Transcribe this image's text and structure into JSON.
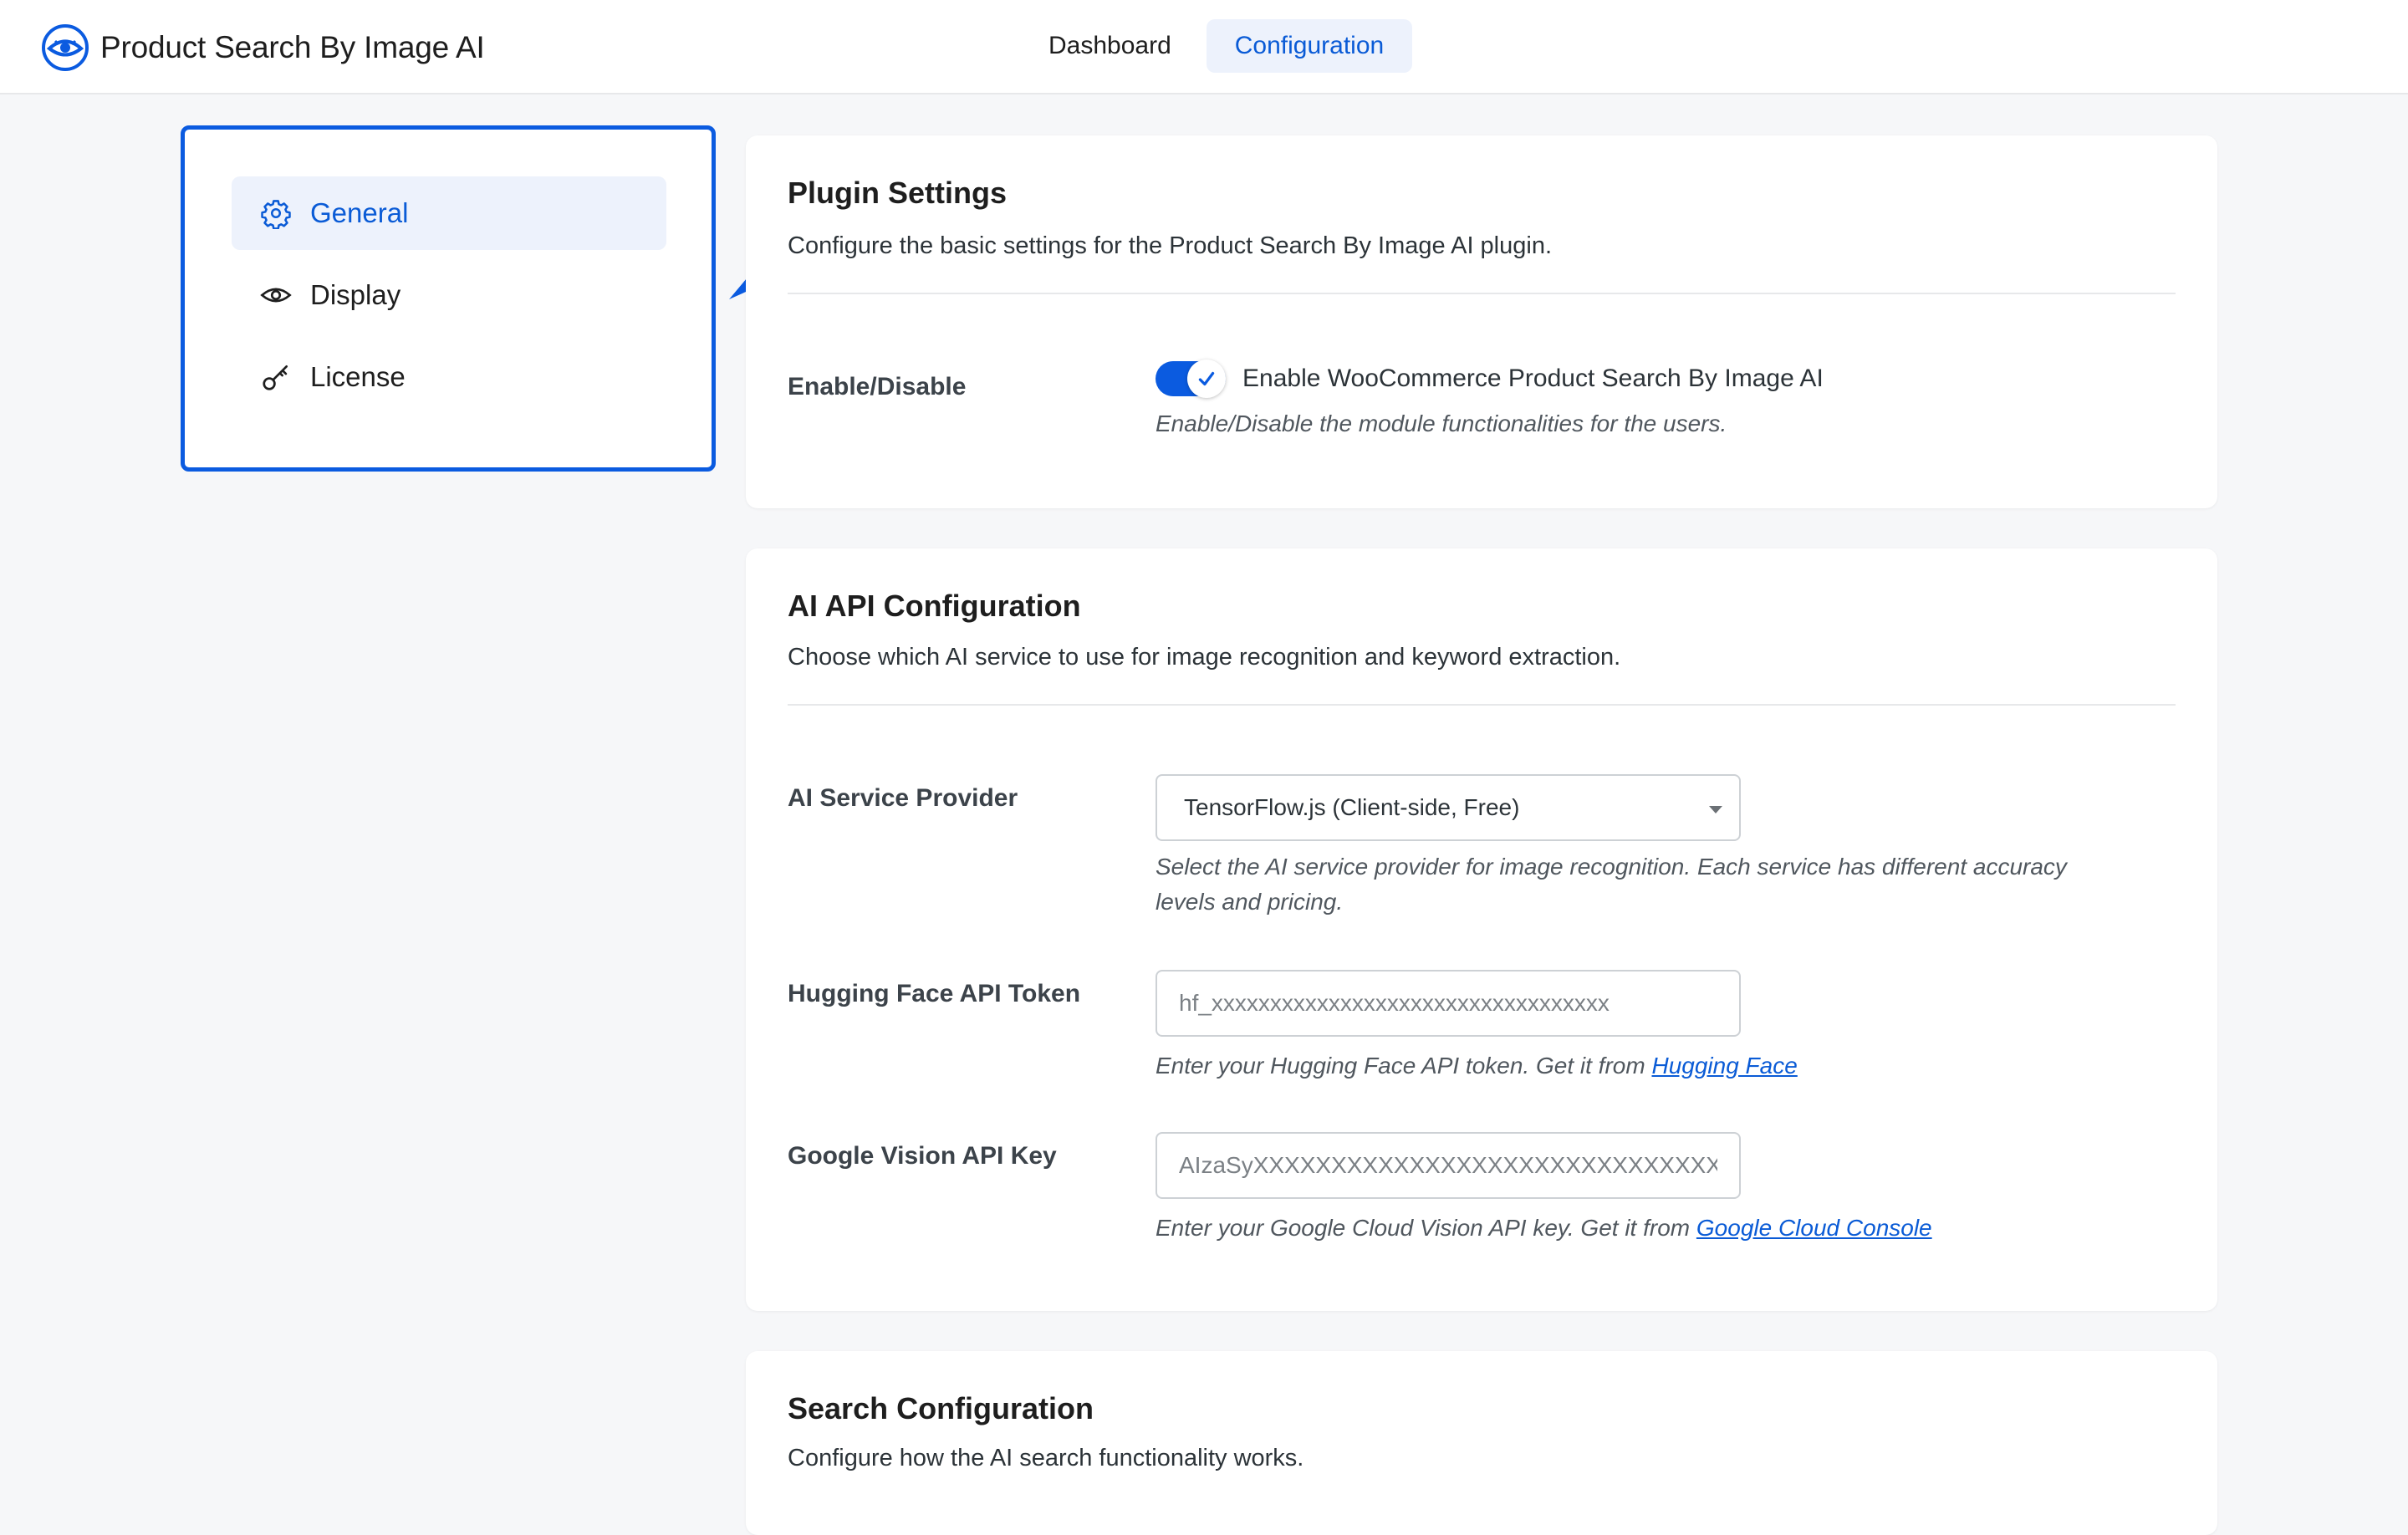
{
  "header": {
    "brand_title": "Product Search By Image AI",
    "brand_icon": "eye-search-icon",
    "tabs": [
      {
        "label": "Dashboard",
        "active": false
      },
      {
        "label": "Configuration",
        "active": true
      }
    ]
  },
  "sidebar": {
    "items": [
      {
        "label": "General",
        "icon": "gear-icon",
        "active": true
      },
      {
        "label": "Display",
        "icon": "eye-icon",
        "active": false
      },
      {
        "label": "License",
        "icon": "key-icon",
        "active": false
      }
    ]
  },
  "plugin_settings": {
    "title": "Plugin Settings",
    "description": "Configure the basic settings for the Product Search By Image AI plugin.",
    "enable_label": "Enable/Disable",
    "enable_toggle_label": "Enable WooCommerce Product Search By Image AI",
    "enable_help": "Enable/Disable the module functionalities for the users.",
    "enabled": true
  },
  "ai_api": {
    "title": "AI API Configuration",
    "description": "Choose which AI service to use for image recognition and keyword extraction.",
    "provider_label": "AI Service Provider",
    "provider_value": "TensorFlow.js (Client-side, Free)",
    "provider_help_line1": "Select the AI service provider for image recognition. Each service has different accuracy",
    "provider_help_line2": "levels and pricing.",
    "hf_label": "Hugging Face API Token",
    "hf_placeholder": "hf_xxxxxxxxxxxxxxxxxxxxxxxxxxxxxxxxxx",
    "hf_help": "Enter your Hugging Face API token. Get it from ",
    "hf_link": "Hugging Face",
    "gv_label": "Google Vision API Key",
    "gv_placeholder": "AIzaSyXXXXXXXXXXXXXXXXXXXXXXXXXXXXXXX",
    "gv_help": "Enter your Google Cloud Vision API key. Get it from ",
    "gv_link": "Google Cloud Console"
  },
  "search_config": {
    "title": "Search Configuration",
    "description": "Configure how the AI search functionality works."
  },
  "colors": {
    "accent": "#0b5be0",
    "active_bg": "#edf2fc",
    "page_bg": "#f6f7f9"
  }
}
